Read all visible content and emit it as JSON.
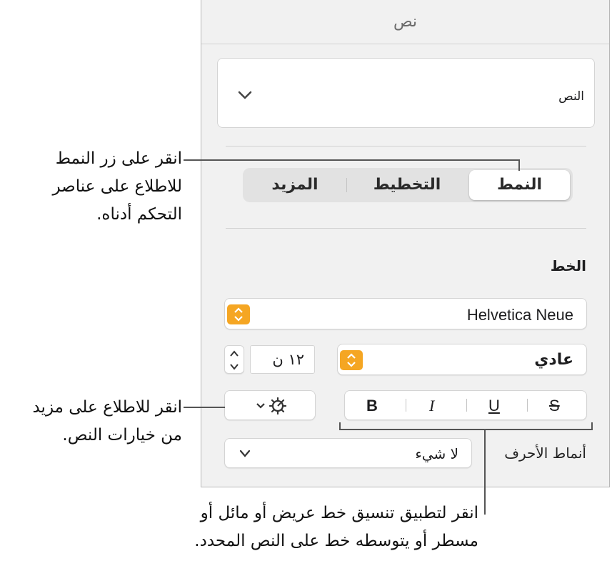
{
  "panel": {
    "title": "نص",
    "paragraph_style": "النص",
    "tabs": [
      {
        "label": "النمط",
        "selected": true
      },
      {
        "label": "التخطيط",
        "selected": false
      },
      {
        "label": "المزيد",
        "selected": false
      }
    ],
    "font_section_title": "الخط",
    "font_name": "Helvetica Neue",
    "typeface": "عادي",
    "font_size": "١٢ ن",
    "format_buttons": {
      "bold": "B",
      "italic": "I",
      "underline": "U",
      "strikethrough": "S"
    },
    "char_styles_label": "أنماط الأحرف",
    "char_styles_value": "لا شيء"
  },
  "callouts": {
    "style_button": [
      "انقر على زر النمط",
      "للاطلاع على عناصر",
      "التحكم أدناه."
    ],
    "more_options": [
      "انقر للاطلاع على مزيد",
      "من خيارات النص."
    ],
    "format_buttons": [
      "انقر لتطبيق تنسيق خط عريض أو مائل أو",
      "مسطر أو يتوسطه خط على النص المحدد."
    ]
  },
  "colors": {
    "accent": "#f5a623",
    "panel_bg": "#f1f1f1"
  },
  "icons": [
    "chevron-down-icon",
    "gear-icon",
    "stepper-icon"
  ]
}
